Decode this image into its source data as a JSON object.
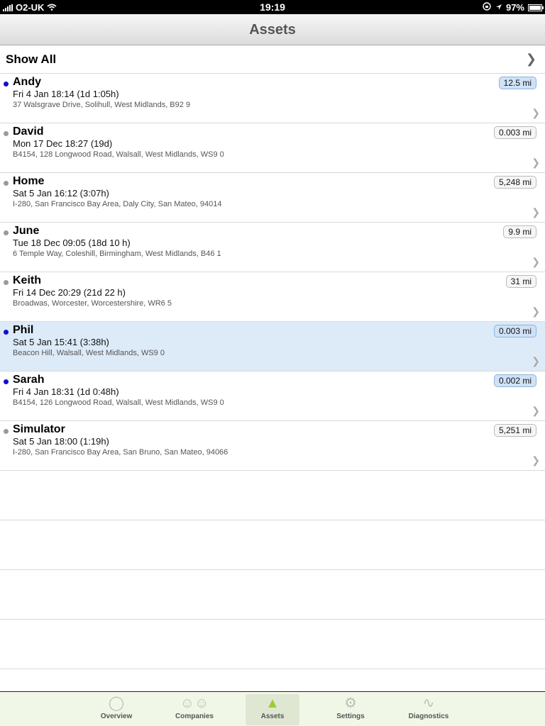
{
  "status": {
    "carrier": "O2-UK",
    "time": "19:19",
    "battery": "97%"
  },
  "nav": {
    "title": "Assets"
  },
  "show_all": "Show All",
  "assets": [
    {
      "name": "Andy",
      "time": "Fri 4 Jan 18:14 (1d 1:05h)",
      "address": "37 Walsgrave Drive, Solihull, West Midlands, B92 9",
      "distance": "12.5 mi",
      "status": "online",
      "badge": "blue"
    },
    {
      "name": "David",
      "time": "Mon 17 Dec 18:27 (19d)",
      "address": "B4154, 128 Longwood Road, Walsall, West Midlands, WS9 0",
      "distance": "0.003 mi",
      "status": "offline",
      "badge": "plain"
    },
    {
      "name": "Home",
      "time": "Sat 5 Jan 16:12 (3:07h)",
      "address": "I-280, San Francisco Bay Area, Daly City, San Mateo, 94014",
      "distance": "5,248 mi",
      "status": "offline",
      "badge": "plain"
    },
    {
      "name": "June",
      "time": "Tue 18 Dec 09:05 (18d 10 h)",
      "address": "6 Temple Way, Coleshill, Birmingham, West Midlands, B46 1",
      "distance": "9.9 mi",
      "status": "offline",
      "badge": "plain"
    },
    {
      "name": "Keith",
      "time": "Fri 14 Dec 20:29 (21d 22 h)",
      "address": "Broadwas, Worcester, Worcestershire, WR6 5",
      "distance": "31 mi",
      "status": "offline",
      "badge": "plain"
    },
    {
      "name": "Phil",
      "time": "Sat 5 Jan 15:41 (3:38h)",
      "address": "Beacon Hill, Walsall, West Midlands, WS9 0",
      "distance": "0.003 mi",
      "status": "online",
      "badge": "blue",
      "selected": true
    },
    {
      "name": "Sarah",
      "time": "Fri 4 Jan 18:31 (1d 0:48h)",
      "address": "B4154, 126 Longwood Road, Walsall, West Midlands, WS9 0",
      "distance": "0.002 mi",
      "status": "online",
      "badge": "blue"
    },
    {
      "name": "Simulator",
      "time": "Sat 5 Jan 18:00 (1:19h)",
      "address": "I-280, San Francisco Bay Area, San Bruno, San Mateo, 94066",
      "distance": "5,251 mi",
      "status": "offline",
      "badge": "plain"
    }
  ],
  "colors": {
    "online": "#1010d0",
    "offline": "#9a9a9a"
  },
  "tabs": [
    {
      "label": "Overview",
      "icon": "overview-icon",
      "active": false
    },
    {
      "label": "Companies",
      "icon": "companies-icon",
      "active": false
    },
    {
      "label": "Assets",
      "icon": "assets-icon",
      "active": true
    },
    {
      "label": "Settings",
      "icon": "settings-icon",
      "active": false
    },
    {
      "label": "Diagnostics",
      "icon": "diagnostics-icon",
      "active": false
    }
  ]
}
